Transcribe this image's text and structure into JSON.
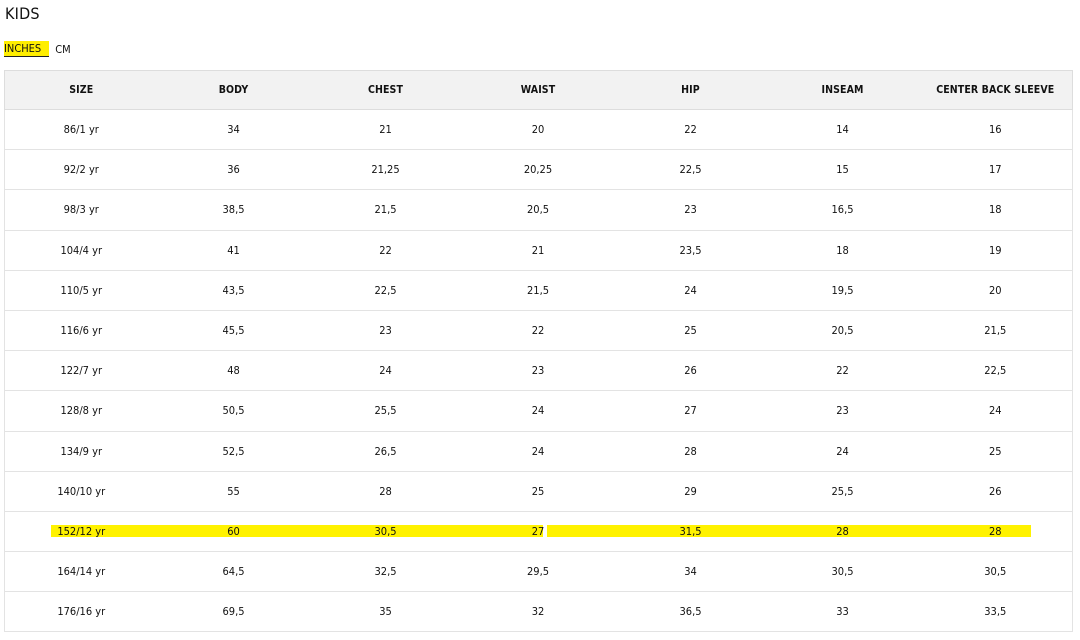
{
  "page": {
    "title": "KIDS"
  },
  "units": {
    "selected": "INCHES",
    "other": "CM"
  },
  "colors": {
    "highlight": "#fff200",
    "header_bg": "#f2f2f2",
    "border": "#e3e3e3"
  },
  "table": {
    "headers": [
      "SIZE",
      "BODY",
      "CHEST",
      "WAIST",
      "HIP",
      "INSEAM",
      "CENTER BACK SLEEVE"
    ],
    "rows": [
      [
        "86/1 yr",
        "34",
        "21",
        "20",
        "22",
        "14",
        "16"
      ],
      [
        "92/2 yr",
        "36",
        "21,25",
        "20,25",
        "22,5",
        "15",
        "17"
      ],
      [
        "98/3 yr",
        "38,5",
        "21,5",
        "20,5",
        "23",
        "16,5",
        "18"
      ],
      [
        "104/4 yr",
        "41",
        "22",
        "21",
        "23,5",
        "18",
        "19"
      ],
      [
        "110/5 yr",
        "43,5",
        "22,5",
        "21,5",
        "24",
        "19,5",
        "20"
      ],
      [
        "116/6 yr",
        "45,5",
        "23",
        "22",
        "25",
        "20,5",
        "21,5"
      ],
      [
        "122/7 yr",
        "48",
        "24",
        "23",
        "26",
        "22",
        "22,5"
      ],
      [
        "128/8 yr",
        "50,5",
        "25,5",
        "24",
        "27",
        "23",
        "24"
      ],
      [
        "134/9 yr",
        "52,5",
        "26,5",
        "24",
        "28",
        "24",
        "25"
      ],
      [
        "140/10 yr",
        "55",
        "28",
        "25",
        "29",
        "25,5",
        "26"
      ],
      [
        "152/12 yr",
        "60",
        "30,5",
        "27",
        "31,5",
        "28",
        "28"
      ],
      [
        "164/14 yr",
        "64,5",
        "32,5",
        "29,5",
        "34",
        "30,5",
        "30,5"
      ],
      [
        "176/16 yr",
        "69,5",
        "35",
        "32",
        "36,5",
        "33",
        "33,5"
      ]
    ],
    "highlighted_row": 10
  }
}
